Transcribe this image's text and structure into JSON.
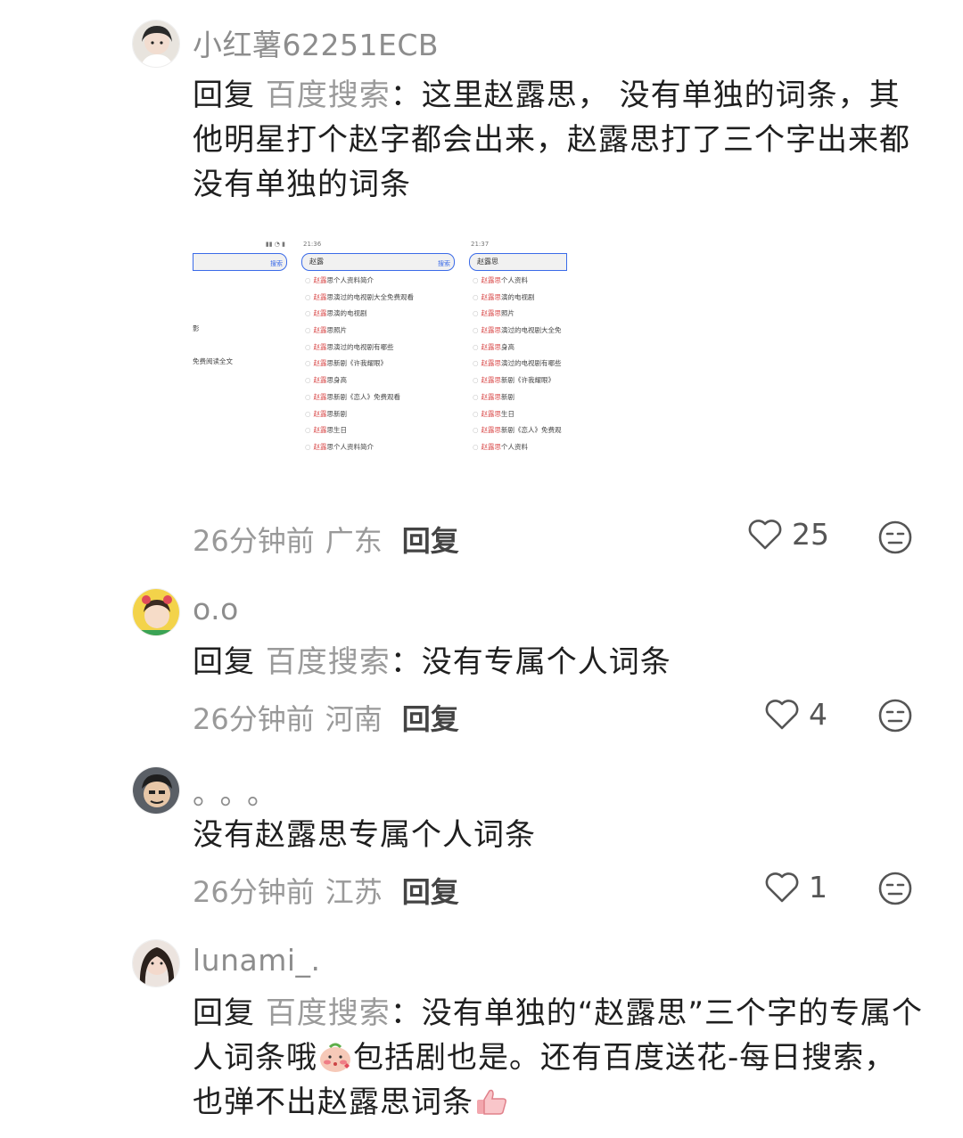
{
  "comments": [
    {
      "username": "小红薯62251ECB",
      "reply_prefix": "回复",
      "reply_target": "百度搜索",
      "text": "：这里赵露思， 没有单独的词条，其他明星打个赵字都会出来，赵露思打了三个字出来都没有单独的词条",
      "time": "26分钟前",
      "location": "广东",
      "reply_label": "回复",
      "likes": "25",
      "avatar_color": "#d8d3cb"
    },
    {
      "username": "o.o",
      "reply_prefix": "回复",
      "reply_target": "百度搜索",
      "text": "：没有专属个人词条",
      "time": "26分钟前",
      "location": "河南",
      "reply_label": "回复",
      "likes": "4",
      "avatar_color": "#f0c84a"
    },
    {
      "username": "。。。",
      "text": "没有赵露思专属个人词条",
      "time": "26分钟前",
      "location": "江苏",
      "reply_label": "回复",
      "likes": "1",
      "avatar_color": "#3a3a3a"
    },
    {
      "username": "lunami_.",
      "reply_prefix": "回复",
      "reply_target": "百度搜索",
      "text_1": "：没有单独的“赵露思”三个字的专属个人词条哦",
      "text_2": "包括剧也是。还有百度送花-每日搜索，也弹不出赵露思词条",
      "avatar_color": "#caa89a"
    }
  ],
  "search_screens": {
    "left": {
      "button": "搜索",
      "rows": [
        "",
        "",
        "",
        "影",
        "",
        "免费阅读全文"
      ]
    },
    "middle": {
      "time": "21:36",
      "query": "赵露",
      "button": "搜索",
      "rows": [
        {
          "hl": "赵露",
          "rest": "思个人资料简介"
        },
        {
          "hl": "赵露",
          "rest": "思演过的电视剧大全免费观看"
        },
        {
          "hl": "赵露",
          "rest": "思演的电视剧"
        },
        {
          "hl": "赵露",
          "rest": "思照片"
        },
        {
          "hl": "赵露",
          "rest": "思演过的电视剧有哪些"
        },
        {
          "hl": "赵露",
          "rest": "思新剧《许我耀眼》"
        },
        {
          "hl": "赵露",
          "rest": "思身高"
        },
        {
          "hl": "赵露",
          "rest": "思新剧《恋人》免费观看"
        },
        {
          "hl": "赵露",
          "rest": "思新剧"
        },
        {
          "hl": "赵露",
          "rest": "思生日"
        },
        {
          "hl": "赵露",
          "rest": "思个人资料简介"
        }
      ]
    },
    "right": {
      "time": "21:37",
      "query": "赵露思",
      "rows": [
        {
          "hl": "赵露思",
          "rest": "个人资料"
        },
        {
          "hl": "赵露思",
          "rest": "演的电视剧"
        },
        {
          "hl": "赵露思",
          "rest": "照片"
        },
        {
          "hl": "赵露思",
          "rest": "演过的电视剧大全免"
        },
        {
          "hl": "赵露思",
          "rest": "身高"
        },
        {
          "hl": "赵露思",
          "rest": "演过的电视剧有哪些"
        },
        {
          "hl": "赵露思",
          "rest": "新剧《许我耀眼》"
        },
        {
          "hl": "赵露思",
          "rest": "新剧"
        },
        {
          "hl": "赵露思",
          "rest": "生日"
        },
        {
          "hl": "赵露思",
          "rest": "新剧《恋人》免费观"
        },
        {
          "hl": "赵露思",
          "rest": "个人资料"
        }
      ]
    }
  },
  "icons": {
    "like": "heart-outline-icon",
    "emoji": "expressionless-face-icon",
    "inline_1": "blushing-face-emoji",
    "inline_2": "thumbs-up-emoji"
  }
}
